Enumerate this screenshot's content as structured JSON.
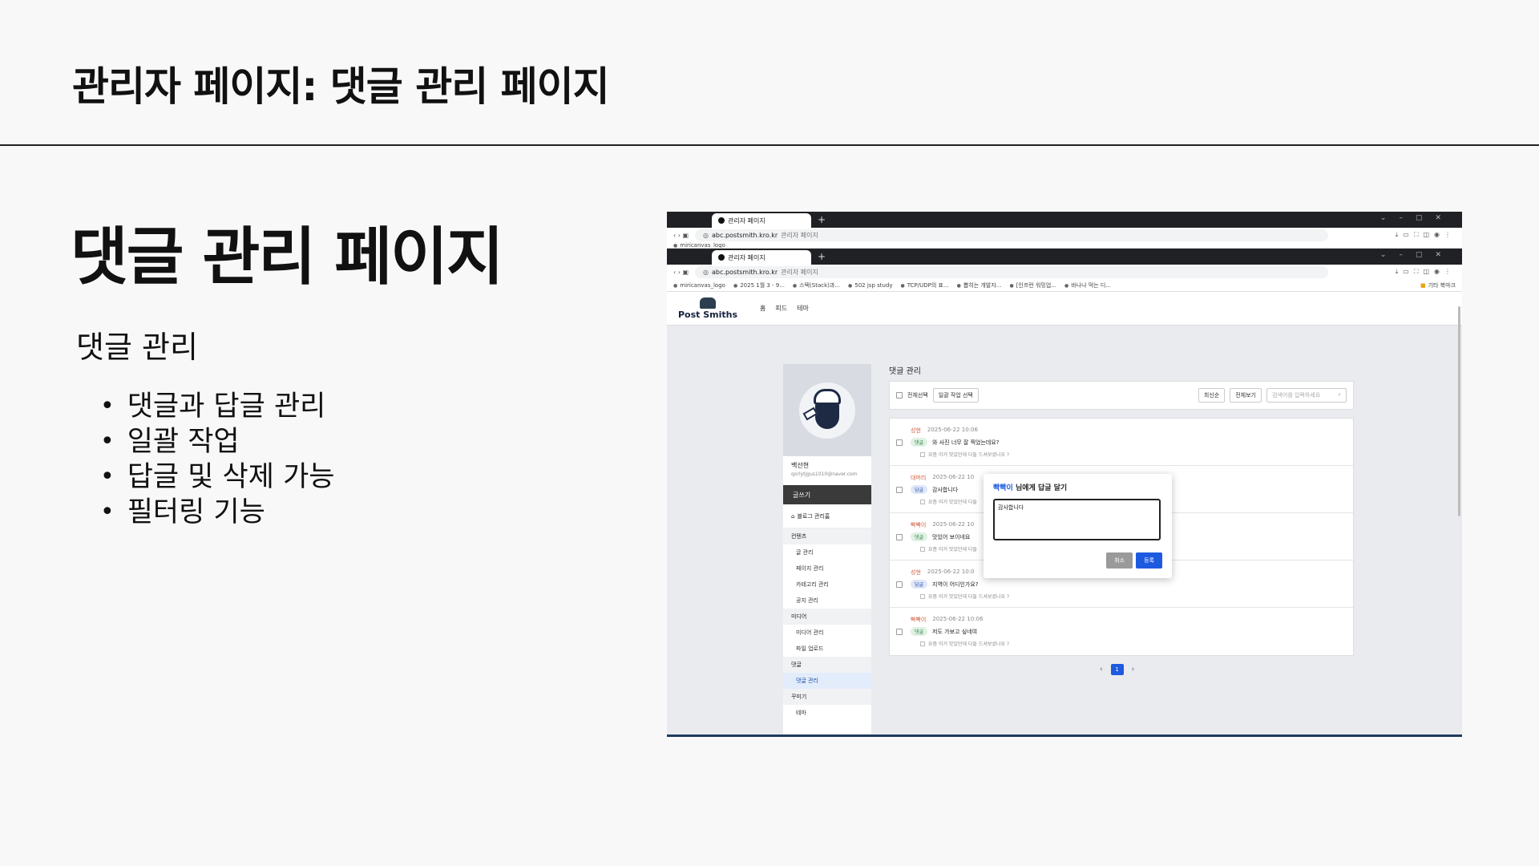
{
  "slide": {
    "title": "관리자 페이지: 댓글 관리 페이지",
    "heading": "댓글 관리 페이지",
    "subheading": "댓글 관리",
    "bullets": [
      "댓글과 답글 관리",
      "일괄 작업",
      "답글 및 삭제 가능",
      "필터링 기능"
    ]
  },
  "browser": {
    "tab_title": "관리자 페이지",
    "url_host": "abc.postsmith.kro.kr",
    "url_title": "관리자 페이지",
    "bookmarks": [
      "miricanvas_logo",
      "2025 1월 3 - 9...",
      "스택(Stack)과...",
      "502 jsp study",
      "TCP/UDP의 표...",
      "뽑히는 개발자...",
      "[인프런 워밍업...",
      "바나나 먹는 디..."
    ],
    "bookmarks_folder": "기타 북마크"
  },
  "app": {
    "logo": "Post Smiths",
    "nav": [
      "홈",
      "피드",
      "테마"
    ]
  },
  "sidebar": {
    "name": "백선현",
    "email": "qorlytjgus1010@naver.com",
    "write": "글쓰기",
    "blog_mgmt": "블로그 관리홈",
    "sections": [
      {
        "title": "컨텐츠",
        "items": [
          "글 관리",
          "페이지 관리",
          "카테고리 관리",
          "공지 관리"
        ]
      },
      {
        "title": "미디어",
        "items": [
          "미디어 관리",
          "파일 업로드"
        ]
      },
      {
        "title": "댓글",
        "items": [
          "댓글 관리"
        ]
      },
      {
        "title": "꾸미기",
        "items": [
          "테마"
        ]
      }
    ]
  },
  "main": {
    "title": "댓글 관리",
    "select_all": "전체선택",
    "bulk_action": "일괄 작업 선택",
    "sort": "최신순",
    "filter": "전체보기",
    "search_placeholder": "검색어를 입력하세요",
    "comments": [
      {
        "author": "성현",
        "time": "2025-06-22 10:06",
        "type": "댓글",
        "text": "와 사진 너무 잘 찍었는데요?",
        "post": "요즘 이거 맛있던데 다들 드셔보셨나요 ?"
      },
      {
        "author": "대머리",
        "time": "2025-06-22 10",
        "type": "답글",
        "text": "감사합니다",
        "post": "요즘 이거 맛있던데 다들"
      },
      {
        "author": "빡빡이",
        "time": "2025-06-22 10",
        "type": "댓글",
        "text": "맛있어 보이네요",
        "post": "요즘 이거 맛있던데 다들"
      },
      {
        "author": "성현",
        "time": "2025-06-22 10:0",
        "type": "답글",
        "text": "지역이 어디인가요?",
        "post": "요즘 이거 맛있던데 다들 드셔보셨나요 ?"
      },
      {
        "author": "빡빡이",
        "time": "2025-06-22 10:06",
        "type": "댓글",
        "text": "저도 가보고 싶네여",
        "post": "요즘 이거 맛있던데 다들 드셔보셨나요 ?"
      }
    ],
    "page": "1"
  },
  "reply_popup": {
    "nickname": "빡빡이",
    "title_suffix": "님에게 답글 달기",
    "text": "감사합니다",
    "cancel": "취소",
    "submit": "등록"
  }
}
